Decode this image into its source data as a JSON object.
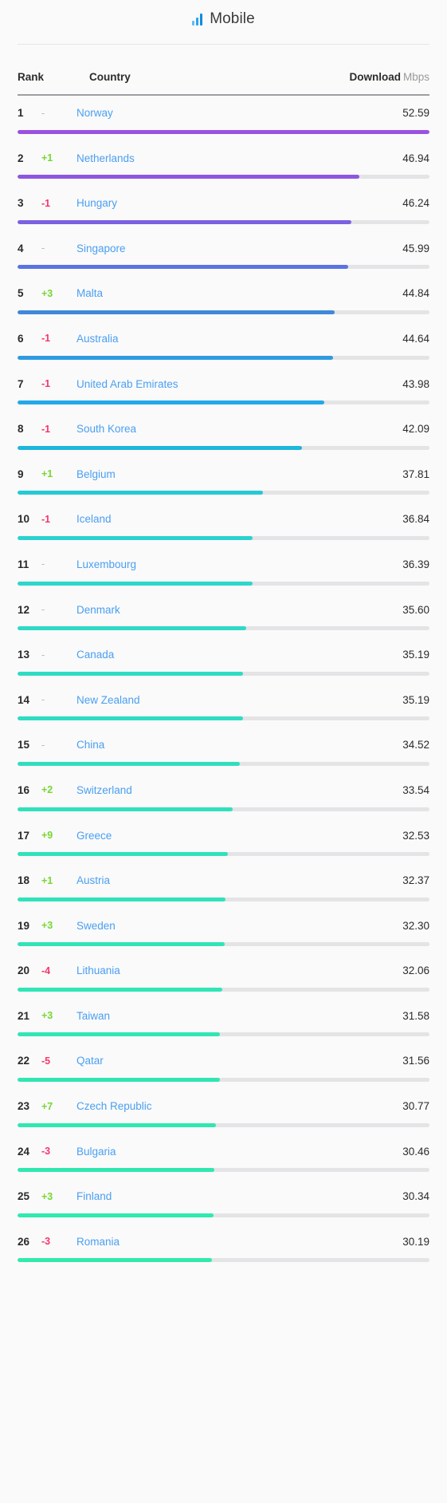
{
  "header": {
    "title": "Mobile",
    "icon": "bar-chart-icon"
  },
  "columns": {
    "rank": "Rank",
    "country": "Country",
    "download": "Download",
    "unit": "Mbps"
  },
  "colors": {
    "link": "#4a9ff2",
    "up": "#76d832",
    "down": "#f8366b",
    "flat": "#b6b6bb",
    "track": "#e4e4e6",
    "bar_top": "#9b51e0",
    "bar_bottom": "#2ee0c4"
  },
  "chart_data": {
    "type": "bar",
    "title": "Mobile",
    "xlabel": "",
    "ylabel": "Download Mbps",
    "categories": [
      "Norway",
      "Netherlands",
      "Hungary",
      "Singapore",
      "Malta",
      "Australia",
      "United Arab Emirates",
      "South Korea",
      "Belgium",
      "Iceland",
      "Luxembourg",
      "Denmark",
      "Canada",
      "New Zealand",
      "China",
      "Switzerland",
      "Greece",
      "Austria",
      "Sweden",
      "Lithuania",
      "Taiwan",
      "Qatar",
      "Czech Republic",
      "Bulgaria",
      "Finland",
      "Romania"
    ],
    "values": [
      52.59,
      46.94,
      46.24,
      45.99,
      44.84,
      44.64,
      43.98,
      42.09,
      37.81,
      36.84,
      36.39,
      35.6,
      35.19,
      35.19,
      34.52,
      33.54,
      32.53,
      32.37,
      32.3,
      32.06,
      31.58,
      31.56,
      30.77,
      30.46,
      30.34,
      30.19
    ],
    "ylim": [
      0,
      52.59
    ],
    "grid": false,
    "legend": false
  },
  "rows": [
    {
      "rank": "1",
      "delta": "-",
      "dir": "flat",
      "country": "Norway",
      "value": "52.59",
      "pct": 100.0,
      "color": "#9b51e0"
    },
    {
      "rank": "2",
      "delta": "+1",
      "dir": "up",
      "country": "Netherlands",
      "value": "46.94",
      "pct": 83.0,
      "color": "#8e57e0"
    },
    {
      "rank": "3",
      "delta": "-1",
      "dir": "down",
      "country": "Hungary",
      "value": "46.24",
      "pct": 81.0,
      "color": "#7b61e3"
    },
    {
      "rank": "4",
      "delta": "-",
      "dir": "flat",
      "country": "Singapore",
      "value": "45.99",
      "pct": 80.3,
      "color": "#5b73e0"
    },
    {
      "rank": "5",
      "delta": "+3",
      "dir": "up",
      "country": "Malta",
      "value": "44.84",
      "pct": 77.0,
      "color": "#3f89d8"
    },
    {
      "rank": "6",
      "delta": "-1",
      "dir": "down",
      "country": "Australia",
      "value": "44.64",
      "pct": 76.5,
      "color": "#2e9be0"
    },
    {
      "rank": "7",
      "delta": "-1",
      "dir": "down",
      "country": "United Arab Emirates",
      "value": "43.98",
      "pct": 74.5,
      "color": "#22a9e8"
    },
    {
      "rank": "8",
      "delta": "-1",
      "dir": "down",
      "country": "South Korea",
      "value": "42.09",
      "pct": 69.0,
      "color": "#1eb7dd"
    },
    {
      "rank": "9",
      "delta": "+1",
      "dir": "up",
      "country": "Belgium",
      "value": "37.81",
      "pct": 59.5,
      "color": "#25c9d6"
    },
    {
      "rank": "10",
      "delta": "-1",
      "dir": "down",
      "country": "Iceland",
      "value": "36.84",
      "pct": 57.0,
      "color": "#2bd2cf"
    },
    {
      "rank": "11",
      "delta": "-",
      "dir": "flat",
      "country": "Luxembourg",
      "value": "36.39",
      "pct": 57.0,
      "color": "#2ed6cb"
    },
    {
      "rank": "12",
      "delta": "-",
      "dir": "flat",
      "country": "Denmark",
      "value": "35.60",
      "pct": 55.6,
      "color": "#2fd9c7"
    },
    {
      "rank": "13",
      "delta": "-",
      "dir": "flat",
      "country": "Canada",
      "value": "35.19",
      "pct": 54.8,
      "color": "#2fdcc4"
    },
    {
      "rank": "14",
      "delta": "-",
      "dir": "flat",
      "country": "New Zealand",
      "value": "35.19",
      "pct": 54.8,
      "color": "#2fdcc4"
    },
    {
      "rank": "15",
      "delta": "-",
      "dir": "flat",
      "country": "China",
      "value": "34.52",
      "pct": 53.9,
      "color": "#30debf"
    },
    {
      "rank": "16",
      "delta": "+2",
      "dir": "up",
      "country": "Switzerland",
      "value": "33.54",
      "pct": 52.2,
      "color": "#31e0bc"
    },
    {
      "rank": "17",
      "delta": "+9",
      "dir": "up",
      "country": "Greece",
      "value": "32.53",
      "pct": 51.0,
      "color": "#31e2ba"
    },
    {
      "rank": "18",
      "delta": "+1",
      "dir": "up",
      "country": "Austria",
      "value": "32.37",
      "pct": 50.4,
      "color": "#31e3b8"
    },
    {
      "rank": "19",
      "delta": "+3",
      "dir": "up",
      "country": "Sweden",
      "value": "32.30",
      "pct": 50.2,
      "color": "#31e4b7"
    },
    {
      "rank": "20",
      "delta": "-4",
      "dir": "down",
      "country": "Lithuania",
      "value": "32.06",
      "pct": 49.8,
      "color": "#31e5b6"
    },
    {
      "rank": "21",
      "delta": "+3",
      "dir": "up",
      "country": "Taiwan",
      "value": "31.58",
      "pct": 49.2,
      "color": "#31e6b4"
    },
    {
      "rank": "22",
      "delta": "-5",
      "dir": "down",
      "country": "Qatar",
      "value": "31.56",
      "pct": 49.2,
      "color": "#31e6b3"
    },
    {
      "rank": "23",
      "delta": "+7",
      "dir": "up",
      "country": "Czech Republic",
      "value": "30.77",
      "pct": 48.1,
      "color": "#30e7b1"
    },
    {
      "rank": "24",
      "delta": "-3",
      "dir": "down",
      "country": "Bulgaria",
      "value": "30.46",
      "pct": 47.7,
      "color": "#30e8af"
    },
    {
      "rank": "25",
      "delta": "+3",
      "dir": "up",
      "country": "Finland",
      "value": "30.34",
      "pct": 47.5,
      "color": "#30e9ae"
    },
    {
      "rank": "26",
      "delta": "-3",
      "dir": "down",
      "country": "Romania",
      "value": "30.19",
      "pct": 47.2,
      "color": "#30eaac"
    }
  ]
}
